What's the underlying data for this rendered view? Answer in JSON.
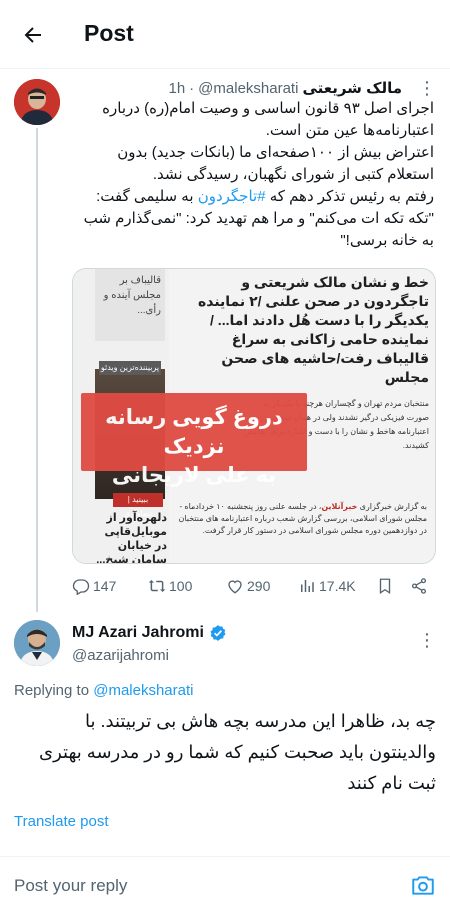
{
  "header": {
    "title": "Post"
  },
  "parent_tweet": {
    "display_name": "مالک شریعتی",
    "handle": "@maleksharati",
    "time": "1h",
    "text_lines": [
      "اجرای اصل ۹۳ قانون اساسی و وصیت امام(ره) درباره",
      "اعتبارنامه‌ها عین متن است.",
      "اعتراض بیش از ۱۰۰صفحه‌ای ما (بانکات جدید) بدون",
      "استعلام کتبی از شورای نگهبان، رسیدگی نشد.",
      "به سلیمی گفت:",
      "\"تکه تکه ات می‌کنم\" و مرا هم تهدید کرد: \"نمی‌گذارم شب",
      "به خانه برسی!\""
    ],
    "line5_prefix": "رفتم به رئیس تذکر دهم که",
    "hashtag": "#تاجگردون",
    "media": {
      "left_top": "قالیباف بر مجلس آینده و رأی...",
      "badge_top": "پربیننده‌ترین ویدئو",
      "badge_bottom": "ببینید | تصاویری",
      "left_bottom": "دلهره‌آور از موبایل‌قاپی در خیابان سامان شیخ...",
      "headline": "خط و نشان مالک شریعتی و تاجگردون در صحن علنی /۲ نماینده یکدیگر را با دست هُل دادند اما... / نماینده حامی زاکانی به سراغ قالیباف رفت/حاشیه های صحن مجلس",
      "body": "منتخبان مردم تهران و گچساران هرچند با یکدیگر به صورت فیزیکی درگیر نشدند ولی در همان ابتدای بررسی اعتبارنامه هاخط و نشان را با دست و اشاره برای یکدیگر کشیدند.",
      "foot_prefix": "به گزارش خبرگزاری",
      "foot_source": "خبرآنلاین",
      "foot_rest": "، در جلسه علنی روز پنجشنبه ۱۰ خردادماه - مجلس شورای اسلامی، بررسی گزارش شعب درباره اعتبارنامه های منتخبان در دوازدهمین دوره مجلس شورای اسلامی در دستور کار قرار گرفت.",
      "banner_line1": "دروغ گویی رسانه نزدیک",
      "banner_line2": "به علی لاریجانی"
    },
    "stats": {
      "replies": "147",
      "reposts": "100",
      "likes": "290",
      "views": "17.4K"
    }
  },
  "reply_tweet": {
    "display_name": "MJ Azari Jahromi",
    "handle": "@azarijahromi",
    "replying_prefix": "Replying to",
    "replying_handle": "@maleksharati",
    "text_lines": [
      "چه بد، ظاهرا این مدرسه بچه هاش بی تربیتند. با",
      "والدینتون باید صحبت کنیم که شما رو در مدرسه بهتری",
      "ثبت نام کنند"
    ],
    "translate_label": "Translate post"
  },
  "composer": {
    "placeholder": "Post your reply"
  },
  "colors": {
    "accent": "#1d9bf0",
    "muted": "#536471",
    "banner": "#e04b43"
  },
  "icons": [
    "back-arrow-icon",
    "more-icon",
    "reply-icon",
    "repost-icon",
    "like-icon",
    "views-icon",
    "bookmark-icon",
    "share-icon",
    "verified-icon",
    "camera-icon"
  ]
}
